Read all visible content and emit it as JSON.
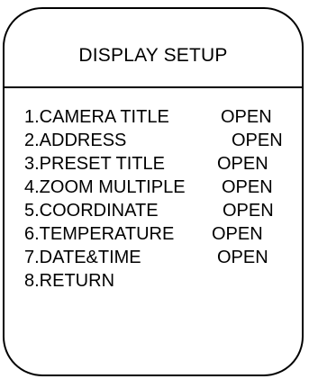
{
  "menu": {
    "title": "DISPLAY SETUP",
    "items": [
      {
        "label": "1.CAMERA TITLE",
        "value": "OPEN"
      },
      {
        "label": "2.ADDRESS",
        "value": "OPEN"
      },
      {
        "label": "3.PRESET TITLE",
        "value": "OPEN"
      },
      {
        "label": "4.ZOOM MULTIPLE",
        "value": "OPEN"
      },
      {
        "label": "5.COORDINATE",
        "value": "OPEN"
      },
      {
        "label": "6.TEMPERATURE",
        "value": "OPEN"
      },
      {
        "label": "7.DATE&TIME",
        "value": "OPEN"
      },
      {
        "label": "8.RETURN"
      }
    ]
  },
  "colors": {
    "background": "#ffffff",
    "text": "#000000",
    "border": "#000000"
  }
}
